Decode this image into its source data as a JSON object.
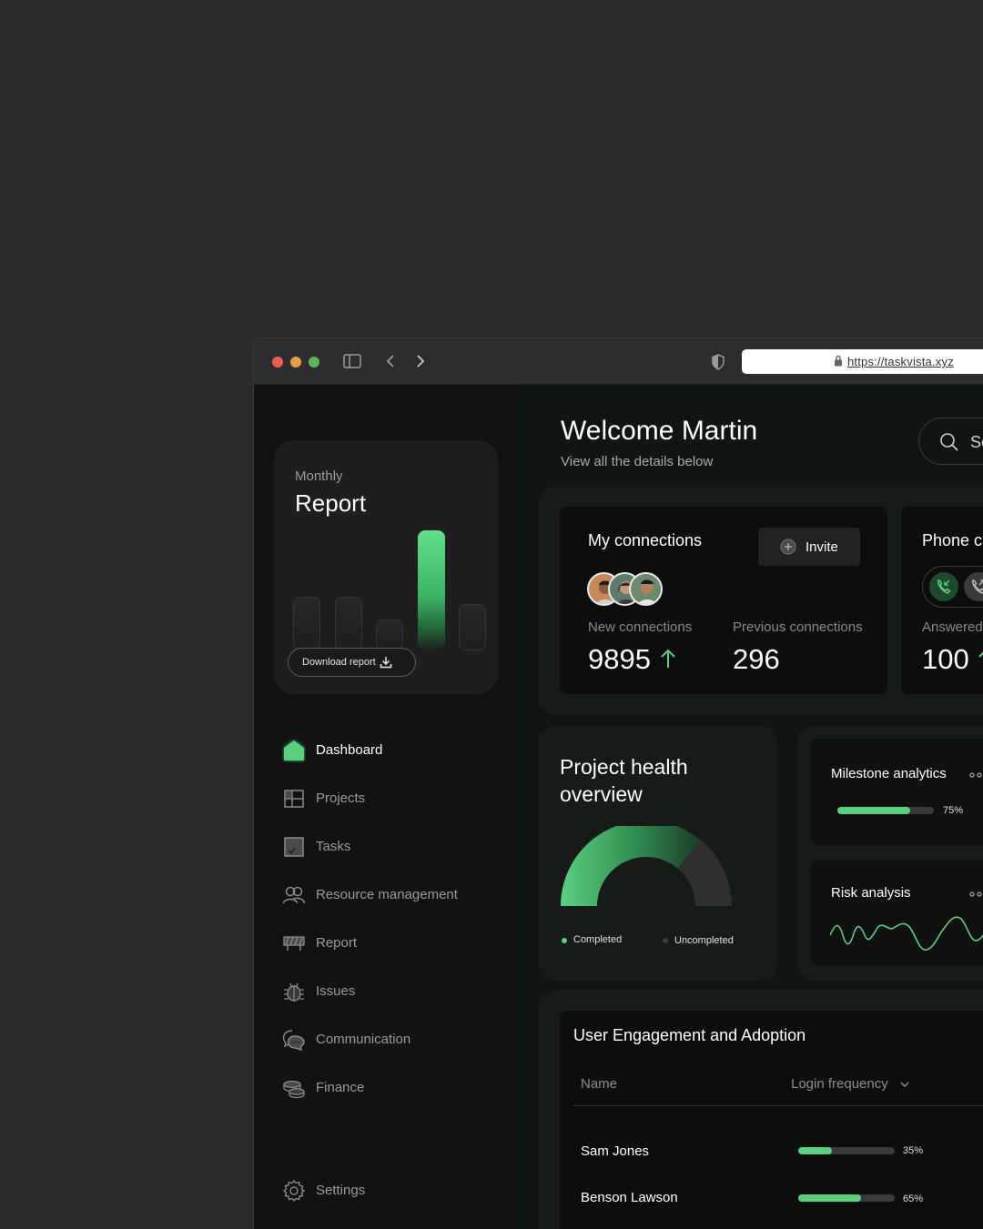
{
  "browser": {
    "url": "https://taskvista.xyz",
    "traffic_colors": [
      "#ec5f57",
      "#e5a047",
      "#5cb557"
    ]
  },
  "sidebar": {
    "report_card": {
      "subtitle": "Monthly",
      "title": "Report",
      "bar_levels": [
        0.45,
        0.45,
        0.26,
        1.0,
        0.39
      ],
      "highlight_index": 3,
      "download_label": "Download report"
    },
    "nav": [
      {
        "label": "Dashboard",
        "icon": "home-icon",
        "active": true
      },
      {
        "label": "Projects",
        "icon": "projects-icon",
        "active": false
      },
      {
        "label": "Tasks",
        "icon": "tasks-icon",
        "active": false
      },
      {
        "label": "Resource management",
        "icon": "users-icon",
        "active": false
      },
      {
        "label": "Report",
        "icon": "report-icon",
        "active": false
      },
      {
        "label": "Issues",
        "icon": "bug-icon",
        "active": false
      },
      {
        "label": "Communication",
        "icon": "chat-icon",
        "active": false
      },
      {
        "label": "Finance",
        "icon": "coins-icon",
        "active": false
      }
    ],
    "settings_label": "Settings"
  },
  "header": {
    "title": "Welcome Martin",
    "subtitle": "View all the details below",
    "search_placeholder": "Se"
  },
  "connections": {
    "title": "My connections",
    "invite_label": "Invite",
    "new_label": "New connections",
    "new_value": "9895",
    "previous_label": "Previous connections",
    "previous_value": "296"
  },
  "phone": {
    "title": "Phone c",
    "answered_label": "Answered",
    "answered_value": "100"
  },
  "project_health": {
    "title_line1": "Project health",
    "title_line2": "overview",
    "completed_label": "Completed",
    "uncompleted_label": "Uncompleted",
    "completed_fraction": 0.72,
    "accent": "#5ad07f"
  },
  "milestone": {
    "title": "Milestone analytics",
    "percent_label": "75%",
    "fraction": 0.75
  },
  "risk": {
    "title": "Risk analysis"
  },
  "engagement": {
    "title": "User Engagement and Adoption",
    "col_name": "Name",
    "col_login": "Login frequency",
    "rows": [
      {
        "name": "Sam Jones",
        "percent_label": "35%",
        "fraction": 0.35
      },
      {
        "name": "Benson Lawson",
        "percent_label": "65%",
        "fraction": 0.65
      }
    ]
  }
}
